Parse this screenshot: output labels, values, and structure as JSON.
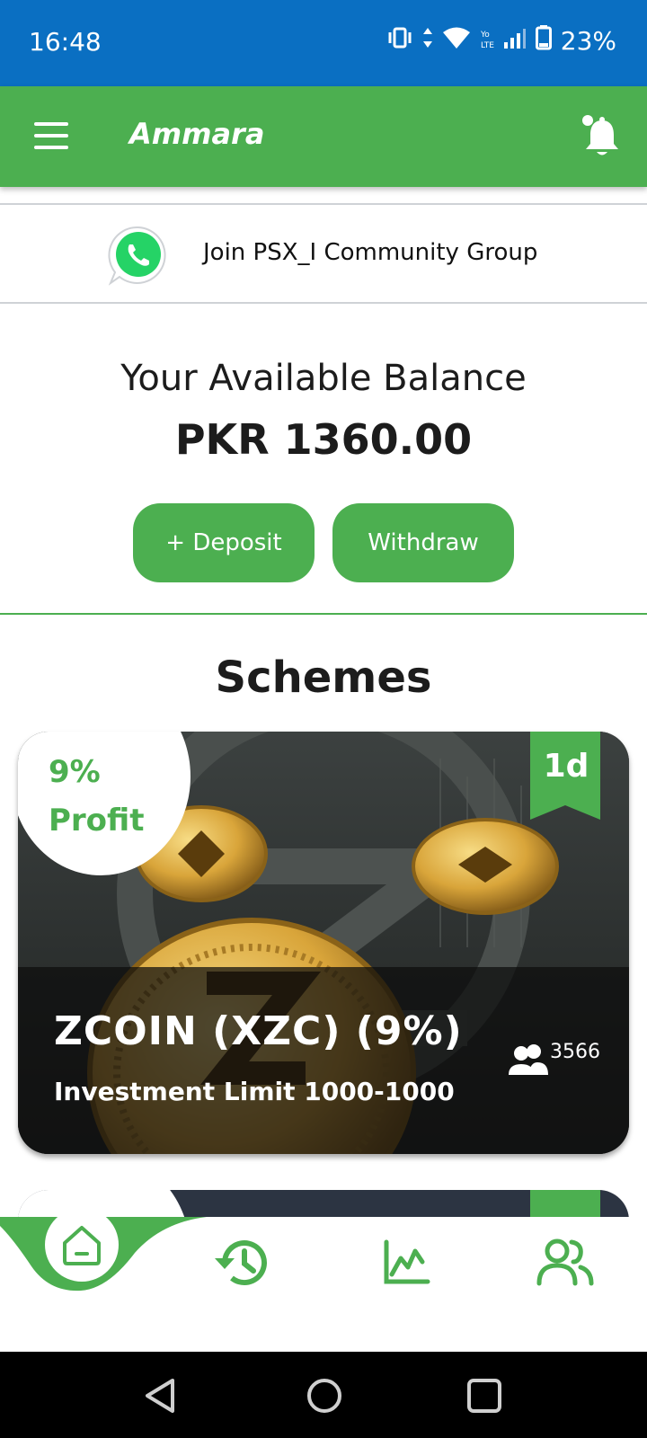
{
  "status_bar": {
    "time": "16:48",
    "battery": "23%"
  },
  "app_bar": {
    "title": "Ammara"
  },
  "community": {
    "label": "Join PSX_I Community Group"
  },
  "balance": {
    "label": "Your Available Balance",
    "value": "PKR 1360.00"
  },
  "actions": {
    "deposit_label": "+ Deposit",
    "withdraw_label": "Withdraw"
  },
  "schemes": {
    "title": "Schemes",
    "items": [
      {
        "profit_line1": "9%",
        "profit_line2": "Profit",
        "duration": "1d",
        "name": "ZCOIN (XZC) (9%)",
        "limit": "Investment Limit 1000-1000",
        "users": "3566"
      }
    ]
  },
  "colors": {
    "brand_green": "#4caf50",
    "status_bar_blue": "#0a6fc2",
    "gold": "#d9a53a"
  },
  "icons": {
    "menu": "hamburger-icon",
    "notification": "bell-icon",
    "community": "whatsapp-icon",
    "users": "users-icon",
    "nav": [
      "home-icon",
      "history-icon",
      "chart-icon",
      "team-icon"
    ],
    "system": [
      "back-icon",
      "home-circle-icon",
      "recents-icon"
    ]
  }
}
